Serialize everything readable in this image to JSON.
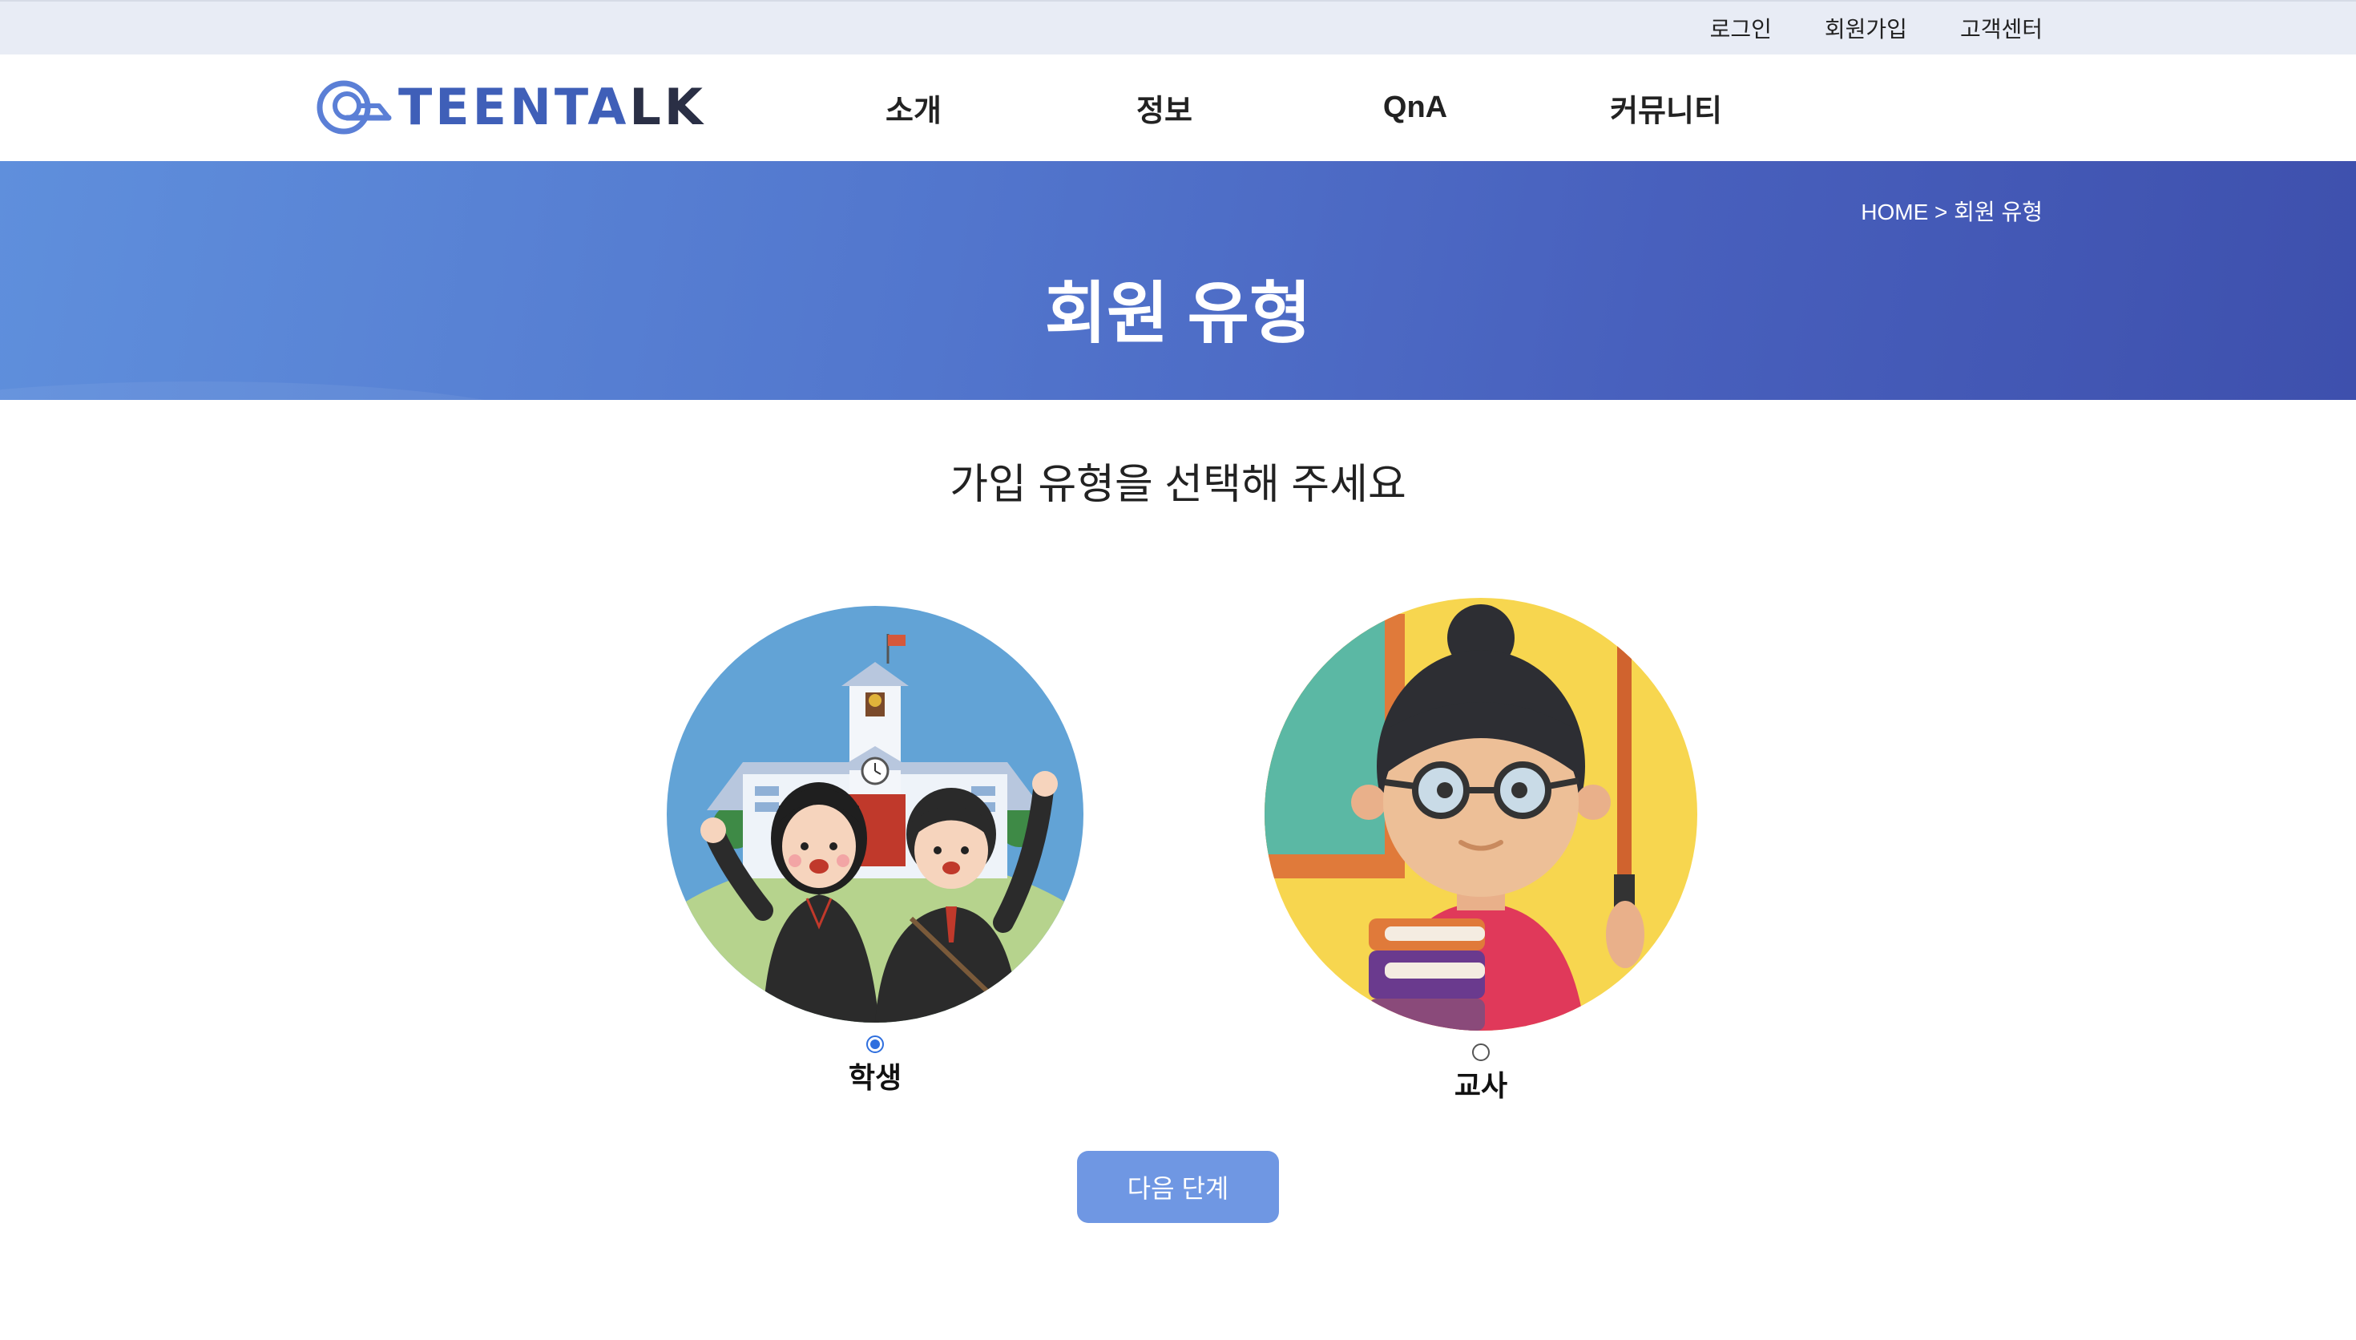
{
  "utility": {
    "login": "로그인",
    "signup": "회원가입",
    "support": "고객센터"
  },
  "brand": {
    "logo_text_a": "TEENTA",
    "logo_text_b": "LK",
    "primary_color": "#3f5fb8",
    "secondary_color": "#2a2f45",
    "logo_icon": "speech-bubble-icon"
  },
  "nav": {
    "items": [
      {
        "label": "소개"
      },
      {
        "label": "정보"
      },
      {
        "label": "QnA"
      },
      {
        "label": "커뮤니티"
      }
    ]
  },
  "hero": {
    "breadcrumb": "HOME > 회원 유형",
    "title": "회원 유형",
    "gradient_start": "#5f8fdc",
    "gradient_end": "#3e50ad"
  },
  "main": {
    "subtitle": "가입 유형을 선택해 주세요",
    "options": [
      {
        "label": "학생",
        "selected": true,
        "illustration": "students-in-front-of-school"
      },
      {
        "label": "교사",
        "selected": false,
        "illustration": "teacher-with-pointer-and-books"
      }
    ],
    "next_button": "다음 단계",
    "button_color": "#6f97e3"
  }
}
